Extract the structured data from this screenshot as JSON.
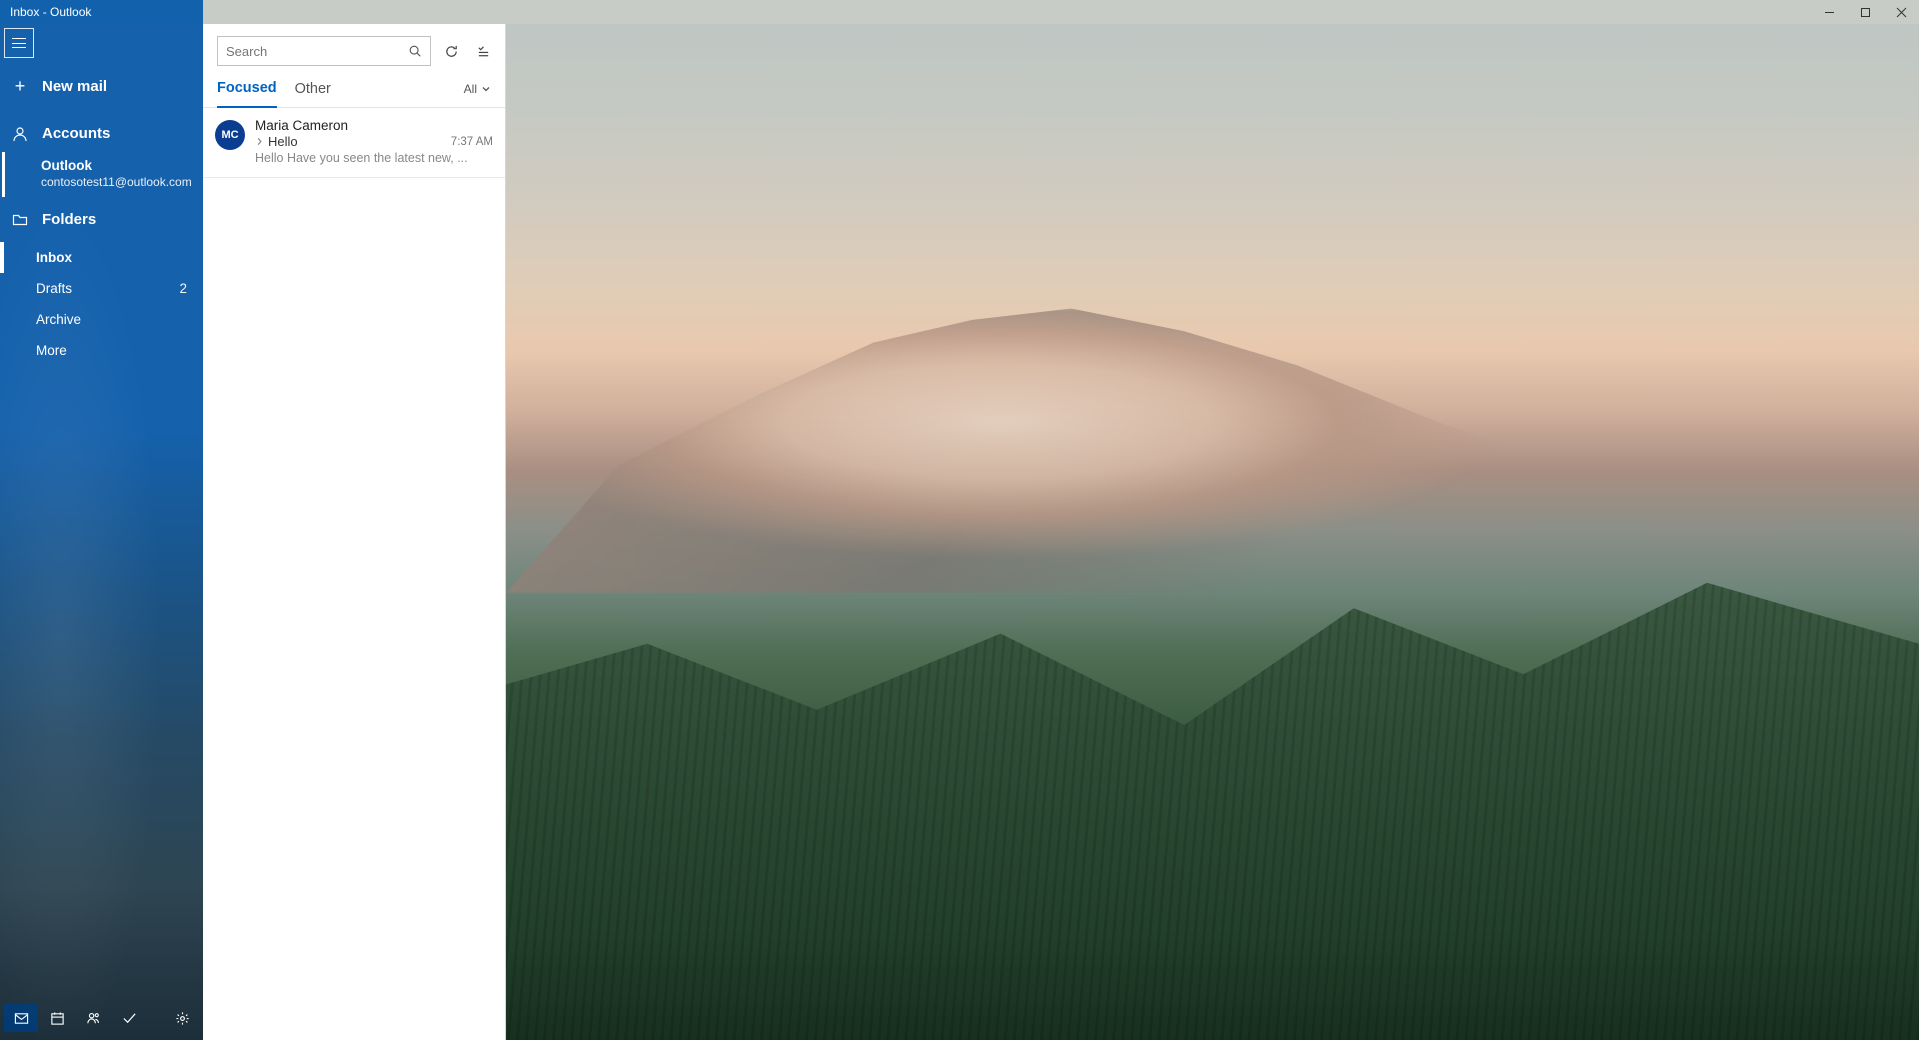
{
  "window": {
    "title": "Inbox - Outlook"
  },
  "sidebar": {
    "new_mail": "New mail",
    "accounts_label": "Accounts",
    "account": {
      "name": "Outlook",
      "email": "contosotest11@outlook.com"
    },
    "folders_label": "Folders",
    "folders": [
      {
        "label": "Inbox",
        "active": true
      },
      {
        "label": "Drafts",
        "count": "2"
      },
      {
        "label": "Archive"
      },
      {
        "label": "More"
      }
    ]
  },
  "list": {
    "search_placeholder": "Search",
    "tabs": {
      "focused": "Focused",
      "other": "Other"
    },
    "filter": "All",
    "messages": [
      {
        "initials": "MC",
        "from": "Maria Cameron",
        "subject": "Hello",
        "time": "7:37 AM",
        "preview": "Hello Have you seen the latest new, ..."
      }
    ]
  }
}
